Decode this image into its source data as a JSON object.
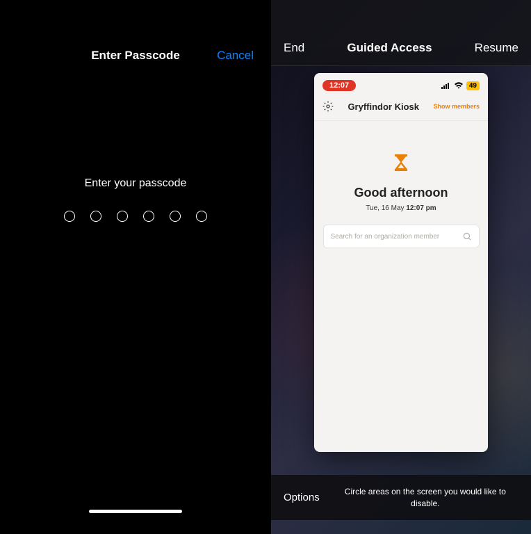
{
  "passcode": {
    "title": "Enter Passcode",
    "cancel": "Cancel",
    "prompt": "Enter your passcode"
  },
  "guided": {
    "end": "End",
    "title": "Guided Access",
    "resume": "Resume"
  },
  "phone": {
    "time": "12:07",
    "battery": "49",
    "app_title": "Gryffindor Kiosk",
    "show_members": "Show members",
    "greeting": "Good afternoon",
    "date_prefix": "Tue, 16 May ",
    "time_suffix": "12:07 pm",
    "search_placeholder": "Search for an organization member"
  },
  "bottom": {
    "options": "Options",
    "hint": "Circle areas on the screen you would like to disable."
  },
  "colors": {
    "accent_blue": "#0a84ff",
    "accent_orange": "#e8810b",
    "time_pill": "#e03424",
    "battery": "#ffc107"
  }
}
